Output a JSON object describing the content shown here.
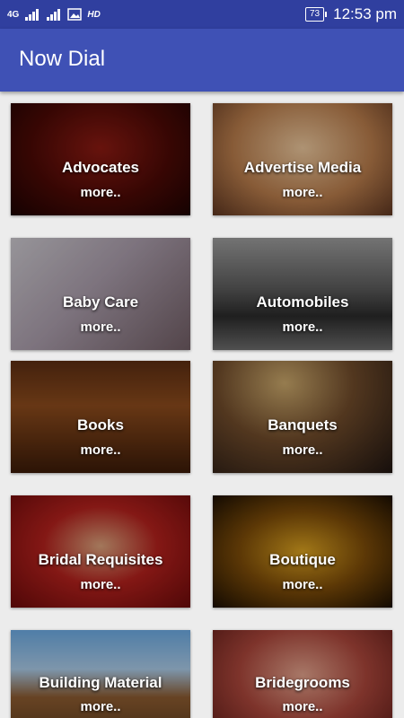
{
  "status_bar": {
    "network": "4G",
    "hd": "HD",
    "battery": "73",
    "time": "12:53 pm"
  },
  "appbar": {
    "title": "Now Dial"
  },
  "more_label": "more..",
  "categories": [
    {
      "name": "Advocates"
    },
    {
      "name": "Advertise Media"
    },
    {
      "name": "Baby Care"
    },
    {
      "name": "Automobiles"
    },
    {
      "name": "Books"
    },
    {
      "name": "Banquets"
    },
    {
      "name": "Bridal Requisites"
    },
    {
      "name": "Boutique"
    },
    {
      "name": "Building Material"
    },
    {
      "name": "Bridegrooms"
    }
  ],
  "colors": {
    "status_bar": "#303f9f",
    "app_bar": "#3f51b5",
    "background": "#ececec"
  }
}
